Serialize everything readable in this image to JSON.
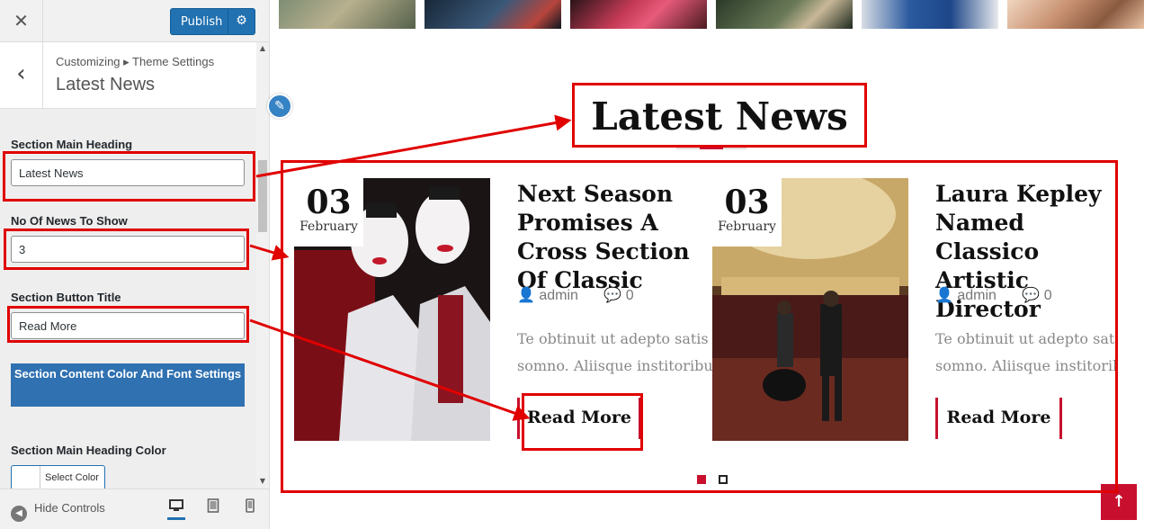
{
  "sidebar": {
    "close_icon": "close-icon",
    "publish_label": "Publish",
    "breadcrumb": "Customizing ▸ Theme Settings",
    "panel_title": "Latest News",
    "controls": {
      "main_heading_label": "Section Main Heading",
      "main_heading_value": "Latest News",
      "news_count_label": "No Of News To Show",
      "news_count_value": "3",
      "button_title_label": "Section Button Title",
      "button_title_value": "Read More",
      "content_settings_button": "Section Content Color And Font Settings",
      "heading_color_label": "Section Main Heading Color",
      "select_color_label": "Select Color"
    },
    "footer": {
      "hide_controls_label": "Hide Controls",
      "devices": [
        "desktop",
        "tablet",
        "mobile"
      ]
    }
  },
  "preview": {
    "section_heading": "Latest News",
    "cards": [
      {
        "day": "03",
        "month": "February",
        "title": "Next Season Promises A Cross Section Of Classic",
        "author": "admin",
        "comments": "0",
        "excerpt_line1": "Te obtinuit ut adepto satis",
        "excerpt_line2": "somno. Aliisque institoribus",
        "button": "Read More"
      },
      {
        "day": "03",
        "month": "February",
        "title": "Laura Kepley Named Classico Artistic Director",
        "author": "admin",
        "comments": "0",
        "excerpt_line1": "Te obtinuit ut adepto satis",
        "excerpt_line2": "somno. Aliisque institoribus",
        "button": "Read More"
      }
    ],
    "pager": {
      "total": 2,
      "active": 1
    },
    "scroll_top_icon": "arrow-up-icon"
  },
  "colors": {
    "accent": "#c8102e",
    "wp_blue": "#2271b1",
    "annotation": "#e00000"
  }
}
